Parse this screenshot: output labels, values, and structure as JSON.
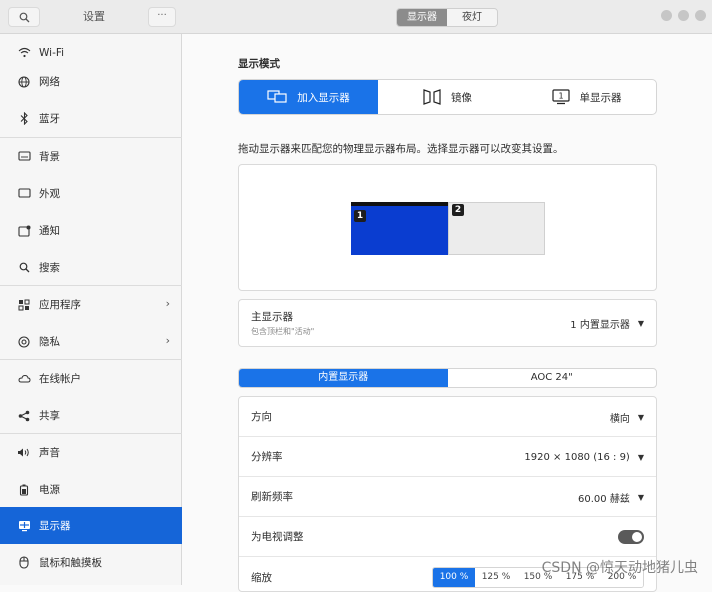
{
  "header": {
    "title": "设置",
    "menu_label": "···",
    "view_tabs": [
      {
        "label": "显示器",
        "active": true
      },
      {
        "label": "夜灯",
        "active": false
      }
    ]
  },
  "sidebar": {
    "items": [
      {
        "label": "Wi-Fi",
        "icon": "wifi-icon"
      },
      {
        "label": "网络",
        "icon": "network-icon"
      },
      {
        "label": "蓝牙",
        "icon": "bluetooth-icon"
      },
      {
        "label": "背景",
        "icon": "background-icon"
      },
      {
        "label": "外观",
        "icon": "appearance-icon"
      },
      {
        "label": "通知",
        "icon": "notification-icon"
      },
      {
        "label": "搜索",
        "icon": "search-icon"
      },
      {
        "label": "应用程序",
        "icon": "apps-icon",
        "chevron": true
      },
      {
        "label": "隐私",
        "icon": "privacy-icon",
        "chevron": true
      },
      {
        "label": "在线帐户",
        "icon": "cloud-icon"
      },
      {
        "label": "共享",
        "icon": "share-icon"
      },
      {
        "label": "声音",
        "icon": "sound-icon"
      },
      {
        "label": "电源",
        "icon": "power-icon"
      },
      {
        "label": "显示器",
        "icon": "display-icon",
        "active": true
      },
      {
        "label": "鼠标和触摸板",
        "icon": "mouse-icon"
      }
    ]
  },
  "main": {
    "display_mode_title": "显示模式",
    "modes": [
      {
        "label": "加入显示器",
        "active": true
      },
      {
        "label": "镜像",
        "active": false
      },
      {
        "label": "单显示器",
        "active": false
      }
    ],
    "arrange_hint": "拖动显示器来匹配您的物理显示器布局。选择显示器可以改变其设置。",
    "monitors": [
      {
        "number": "1",
        "selected": true
      },
      {
        "number": "2",
        "selected": false
      }
    ],
    "primary": {
      "label": "主显示器",
      "subtitle": "包含顶栏和\"活动\"",
      "value": "1  内置显示器"
    },
    "display_tabs": [
      {
        "label": "内置显示器",
        "active": true
      },
      {
        "label": "AOC 24\"",
        "active": false
      }
    ],
    "settings": {
      "orientation": {
        "label": "方向",
        "value": "横向"
      },
      "resolution": {
        "label": "分辨率",
        "value": "1920 × 1080 (16 : 9)"
      },
      "refresh": {
        "label": "刷新频率",
        "value": "60.00 赫兹"
      },
      "tv_adjust": {
        "label": "为电视调整",
        "enabled": true
      },
      "scale": {
        "label": "缩放",
        "options": [
          "100 %",
          "125 %",
          "150 %",
          "175 %",
          "200 %"
        ],
        "selected": "100 %"
      }
    }
  },
  "watermark": "CSDN @惊天动地猪儿虫",
  "colors": {
    "accent": "#1a73e8",
    "sidebar_active": "#1565d8",
    "monitor_selected": "#0a3dd0"
  }
}
